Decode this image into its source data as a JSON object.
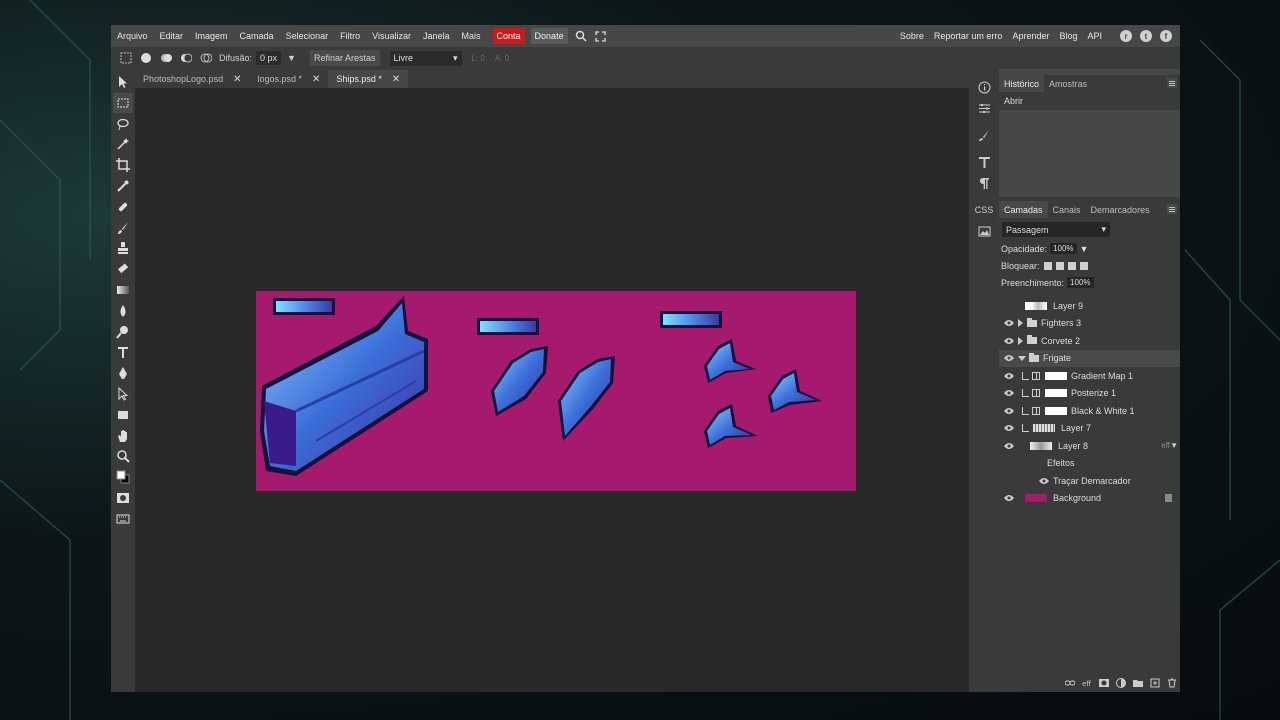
{
  "menubar": {
    "items": [
      "Arquivo",
      "Editar",
      "Imagem",
      "Camada",
      "Selecionar",
      "Filtro",
      "Visualizar",
      "Janela",
      "Mais"
    ],
    "conta": "Conta",
    "donate": "Donate",
    "right_items": [
      "Sobre",
      "Reportar um erro",
      "Aprender",
      "Blog",
      "API"
    ],
    "social_icons": [
      "reddit-icon",
      "twitter-icon",
      "facebook-icon"
    ]
  },
  "options": {
    "difusao_label": "Difusão:",
    "difusao_value": "0 px",
    "refinar": "Refinar Arestas",
    "style_value": "Livre",
    "w_label": "L: 0",
    "h_label": "A: 0"
  },
  "tabs": [
    {
      "label": "PhotoshopLogo.psd",
      "active": false
    },
    {
      "label": "logos.psd *",
      "active": false
    },
    {
      "label": "Ships.psd *",
      "active": true
    }
  ],
  "canvas": {
    "background_color": "#a51a6e"
  },
  "history_panel": {
    "tabs": [
      "Histórico",
      "Amostras"
    ],
    "items": [
      "Abrir"
    ]
  },
  "layers_panel": {
    "tabs": [
      "Camadas",
      "Canais",
      "Demarcadores"
    ],
    "blend_mode": "Passagem",
    "opacity_label": "Opacidade:",
    "opacity_value": "100%",
    "lock_label": "Bloquear:",
    "fill_label": "Preenchimento:",
    "fill_value": "100%",
    "layers": [
      {
        "name": "Layer 9",
        "visible": false
      },
      {
        "name": "Fighters 3",
        "type": "group",
        "expanded": false
      },
      {
        "name": "Corvete 2",
        "type": "group",
        "expanded": false
      },
      {
        "name": "Frigate",
        "type": "group",
        "expanded": true,
        "selected": true
      },
      {
        "name": "Gradient Map 1",
        "type": "adjustment"
      },
      {
        "name": "Posterize 1",
        "type": "adjustment"
      },
      {
        "name": "Black & White 1",
        "type": "adjustment"
      },
      {
        "name": "Layer 7"
      },
      {
        "name": "Layer 8",
        "fx": "eff"
      },
      {
        "name": "Efeitos",
        "type": "effects"
      },
      {
        "name": "Traçar Demarcador",
        "type": "effect"
      },
      {
        "name": "Background",
        "locked": true
      }
    ]
  },
  "side_icons": {
    "css_label": "CSS"
  }
}
